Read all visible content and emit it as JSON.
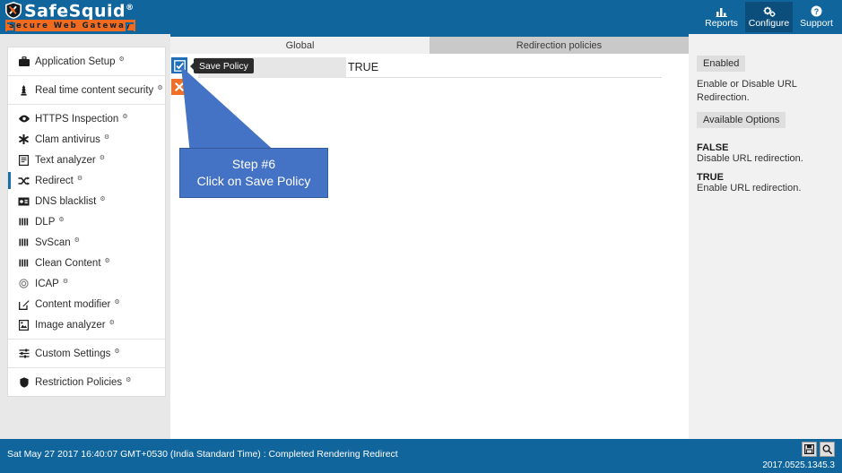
{
  "brand": {
    "name": "SafeSquid",
    "registered_mark": "®",
    "tagline": "Secure Web Gateway",
    "header_color": "#10659c",
    "accent_color": "#f06a20"
  },
  "topnav": {
    "items": [
      {
        "label": "Reports",
        "icon": "chart-icon",
        "active": false
      },
      {
        "label": "Configure",
        "icon": "gears-icon",
        "active": true
      },
      {
        "label": "Support",
        "icon": "question-circle-icon",
        "active": false
      }
    ],
    "active_color": "#0c4e7b"
  },
  "sidebar": {
    "groups": [
      {
        "items": [
          {
            "label": "Application Setup",
            "icon": "briefcase-icon",
            "active": false,
            "gear": "⚙"
          }
        ]
      },
      {
        "items": [
          {
            "label": "Real time content security",
            "icon": "tower-icon",
            "active": false,
            "gear": "⚙"
          }
        ]
      },
      {
        "items": [
          {
            "label": "HTTPS Inspection",
            "icon": "eye-icon",
            "active": false,
            "gear": "⚙"
          },
          {
            "label": "Clam antivirus",
            "icon": "asterisk-icon",
            "active": false,
            "gear": "⚙"
          },
          {
            "label": "Text analyzer",
            "icon": "text-file-icon",
            "active": false,
            "gear": "⚙"
          },
          {
            "label": "Redirect",
            "icon": "shuffle-icon",
            "active": true,
            "gear": "⚙"
          },
          {
            "label": "DNS blacklist",
            "icon": "id-badge-icon",
            "active": false,
            "gear": "⚙"
          },
          {
            "label": "DLP",
            "icon": "bars-icon",
            "active": false,
            "gear": "⚙"
          },
          {
            "label": "SvScan",
            "icon": "bars-icon",
            "active": false,
            "gear": "⚙"
          },
          {
            "label": "Clean Content",
            "icon": "bars-icon",
            "active": false,
            "gear": "⚙"
          },
          {
            "label": "ICAP",
            "icon": "gear-outline-icon",
            "active": false,
            "gear": "⚙"
          },
          {
            "label": "Content modifier",
            "icon": "edit-square-icon",
            "active": false,
            "gear": "⚙"
          },
          {
            "label": "Image analyzer",
            "icon": "image-icon",
            "active": false,
            "gear": "⚙"
          }
        ]
      },
      {
        "items": [
          {
            "label": "Custom Settings",
            "icon": "sliders-icon",
            "active": false,
            "gear": "⚙"
          }
        ]
      },
      {
        "items": [
          {
            "label": "Restriction Policies",
            "icon": "shield-icon",
            "active": false,
            "gear": "⚙"
          }
        ]
      }
    ]
  },
  "tabs": [
    {
      "label": "Global",
      "active": true
    },
    {
      "label": "Redirection policies",
      "active": false
    }
  ],
  "main": {
    "save_button": {
      "name": "Save Policy",
      "icon": "checkbox-check-icon",
      "color": "#1e6fb8"
    },
    "cancel_button": {
      "icon": "close-x-icon",
      "color": "#ef7026"
    },
    "tooltip": "Save Policy",
    "field": {
      "label": "",
      "value": "TRUE"
    }
  },
  "callout": {
    "line1": "Step #6",
    "line2": "Click on Save Policy",
    "color": "#4472c4"
  },
  "help": {
    "heading_badge": "Enabled",
    "description": "Enable or Disable URL Redirection.",
    "options_badge": "Available Options",
    "options": [
      {
        "name": "FALSE",
        "description": "Disable URL redirection."
      },
      {
        "name": "TRUE",
        "description": "Enable URL redirection."
      }
    ]
  },
  "footer": {
    "status": "Sat May 27 2017 16:40:07 GMT+0530 (India Standard Time) : Completed Rendering Redirect",
    "icons": [
      {
        "name": "save-disk-icon"
      },
      {
        "name": "search-icon"
      }
    ],
    "version": "2017.0525.1345.3"
  }
}
